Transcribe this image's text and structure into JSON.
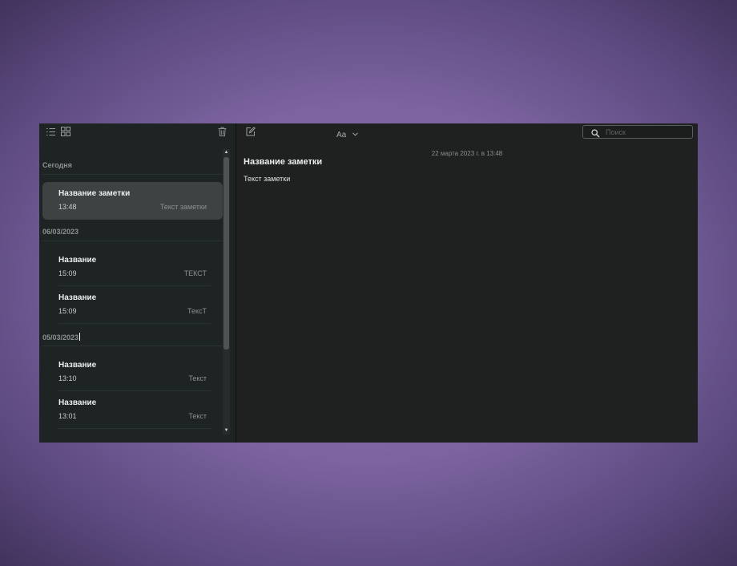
{
  "sidebar": {
    "toolbar": {
      "list_view_icon": "list-icon",
      "grid_view_icon": "grid-icon",
      "delete_icon": "trash-icon"
    },
    "groups": [
      {
        "label": "Сегодня",
        "notes": [
          {
            "title": "Название заметки",
            "time": "13:48",
            "preview": "Текст заметки",
            "selected": true
          }
        ]
      },
      {
        "label": "06/03/2023",
        "notes": [
          {
            "title": "Название",
            "time": "15:09",
            "preview": "ТЕКСТ",
            "selected": false
          },
          {
            "title": "Название",
            "time": "15:09",
            "preview": "ТексТ",
            "selected": false
          }
        ]
      },
      {
        "label": "05/03/2023",
        "notes": [
          {
            "title": "Название",
            "time": "13:10",
            "preview": "Текст",
            "selected": false
          },
          {
            "title": "Название",
            "time": "13:01",
            "preview": "Текст",
            "selected": false
          }
        ]
      }
    ]
  },
  "editor": {
    "toolbar": {
      "compose_icon": "compose-icon",
      "format_label": "Aa",
      "format_chevron_icon": "chevron-down-icon",
      "search_icon": "search-icon",
      "search_placeholder": "Поиск",
      "search_value": ""
    },
    "note": {
      "date": "22 марта 2023 г. в 13:48",
      "title": "Название заметки",
      "body": "Текст заметки"
    }
  },
  "colors": {
    "background_purple": "#7c64a0",
    "sidebar_bg": "#1e2423",
    "editor_bg": "#1f2020",
    "selected_note_bg": "#3e4242"
  }
}
